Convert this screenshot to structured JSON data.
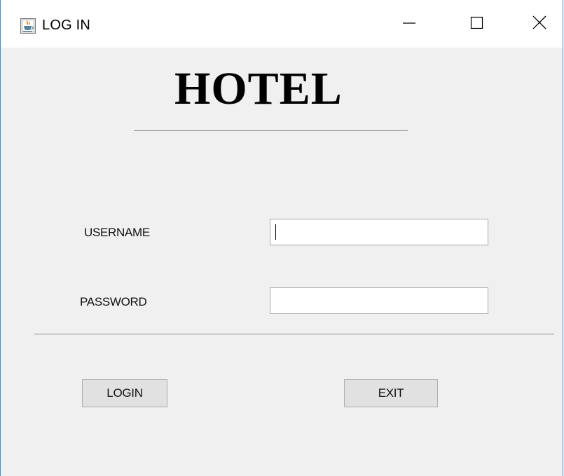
{
  "window": {
    "title": "LOG IN",
    "icons": {
      "app": "java-cup-icon",
      "minimize": "minimize-icon",
      "maximize": "maximize-icon",
      "close": "close-icon"
    }
  },
  "form": {
    "heading": "HOTEL",
    "username_label": "USERNAME",
    "password_label": "PASSWORD",
    "username_value": "",
    "password_value": "",
    "login_label": "LOGIN",
    "exit_label": "EXIT"
  },
  "colors": {
    "window_bg": "#f0f0f0",
    "titlebar_bg": "#ffffff",
    "window_border": "#3c8fd8",
    "button_bg": "#e1e1e1"
  }
}
